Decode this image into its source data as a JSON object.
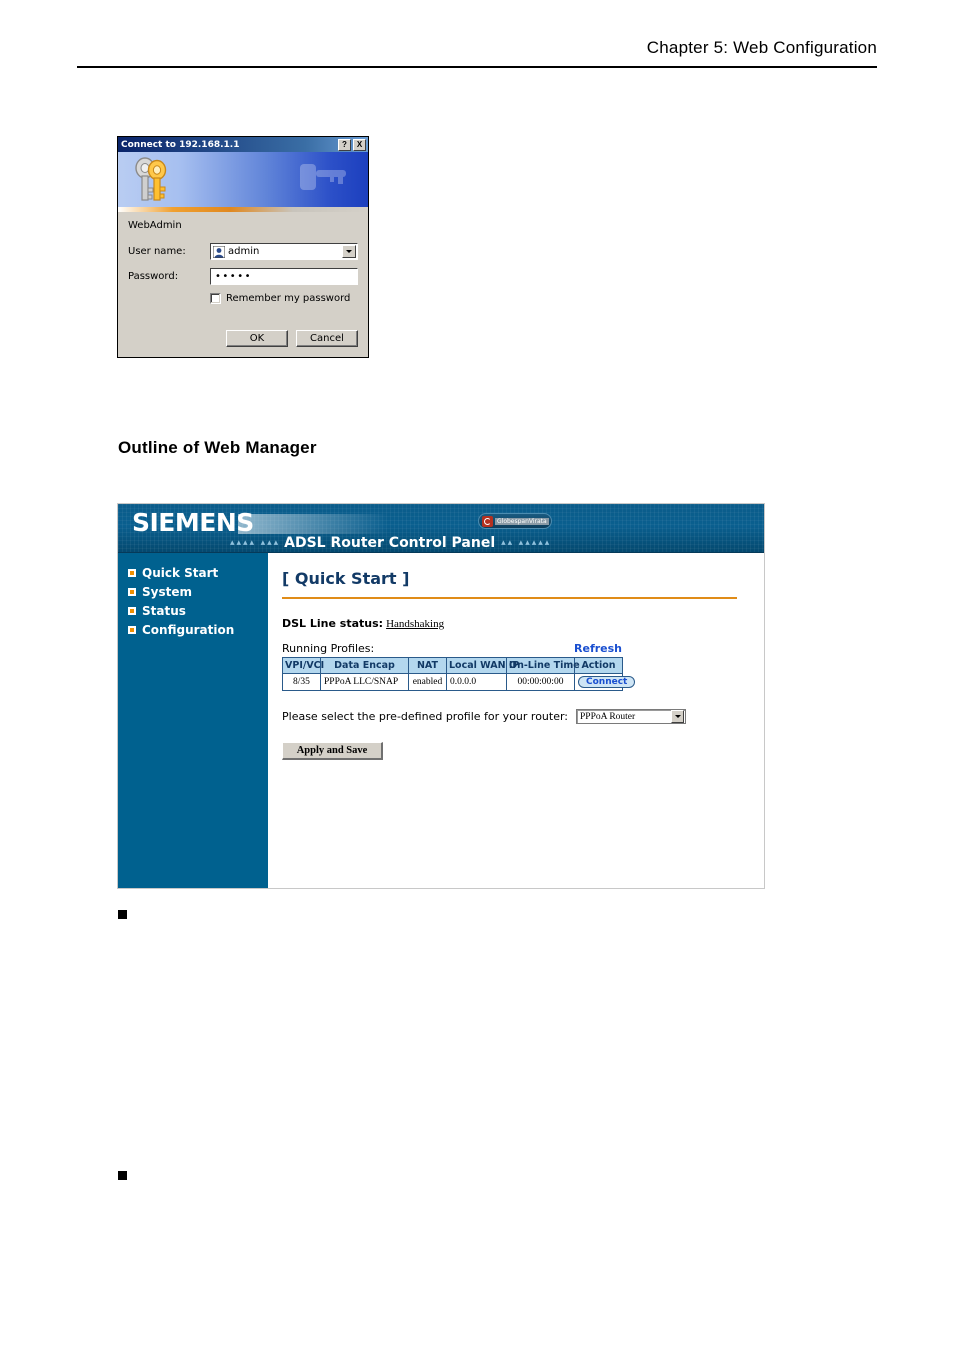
{
  "page": {
    "chapter_title": "Chapter 5: Web Configuration",
    "section_heading": "Outline of Web Manager"
  },
  "auth_dialog": {
    "title": "Connect to 192.168.1.1",
    "help_button": "?",
    "close_button": "X",
    "realm_label": "WebAdmin",
    "username_label": "User name:",
    "username_value": "admin",
    "password_label": "Password:",
    "password_value": "•••••",
    "remember_label": "Remember my password",
    "remember_checked": false,
    "ok_label": "OK",
    "cancel_label": "Cancel",
    "icons": {
      "keys": "keys-icon",
      "user": "user-icon"
    }
  },
  "router_panel": {
    "brand": "SIEMENS",
    "subtitle": "ADSL Router  Control Panel",
    "dots_left": "▴▴▴▴ ▴▴▴",
    "dots_right": "▴▴ ▴▴▴▴▴",
    "partner_badge": "GlobespanVirata",
    "sidebar": {
      "items": [
        {
          "label": "Quick Start"
        },
        {
          "label": "System"
        },
        {
          "label": "Status"
        },
        {
          "label": "Configuration"
        }
      ]
    },
    "content": {
      "title": "[ Quick Start ]",
      "dsl_status_label": "DSL Line status:",
      "dsl_status_value": "Handshaking",
      "profiles_label": "Running Profiles:",
      "refresh_label": "Refresh",
      "table": {
        "headers": [
          "VPI/VCI",
          "Data Encap",
          "NAT",
          "Local WAN IP",
          "On-Line Time",
          "Action"
        ],
        "rows": [
          {
            "vpi_vci": "8/35",
            "data_encap": "PPPoA  LLC/SNAP",
            "nat": "enabled",
            "local_wan_ip": "0.0.0.0",
            "online_time": "00:00:00:00",
            "action": "Connect"
          }
        ]
      },
      "select_label": "Please select the pre-defined profile for your router:",
      "select_value": "PPPoA Router",
      "apply_label": "Apply and Save"
    }
  },
  "colors": {
    "sidebar_blue": "#00618f",
    "header_blue": "#0a5f8f",
    "accent_orange": "#e08c18",
    "link_blue": "#1a4fd0",
    "title_navy": "#123a66",
    "table_header_blue": "#b3d7ee"
  }
}
